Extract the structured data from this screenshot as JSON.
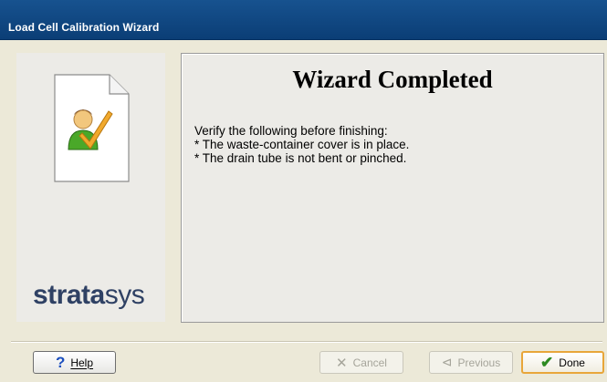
{
  "window": {
    "title": "Load Cell Calibration Wizard"
  },
  "sidebar": {
    "brand_bold": "strata",
    "brand_regular": "sys"
  },
  "main": {
    "heading": "Wizard Completed",
    "lines": [
      "Verify the following before finishing:",
      "* The waste-container cover is in place.",
      "* The drain tube is not bent or pinched."
    ]
  },
  "buttons": {
    "help": "Help",
    "cancel": "Cancel",
    "previous": "Previous",
    "done": "Done"
  },
  "icons": {
    "help": "question-mark-icon",
    "cancel": "x-icon",
    "previous": "back-arrow-icon",
    "done": "checkmark-icon",
    "wizard": "user-check-document-icon"
  },
  "colors": {
    "titlebar": "#0b3e76",
    "brand": "#2f4164",
    "done_border": "#e8a63a",
    "help_icon": "#1b4fbf",
    "check": "#2d8a21"
  }
}
